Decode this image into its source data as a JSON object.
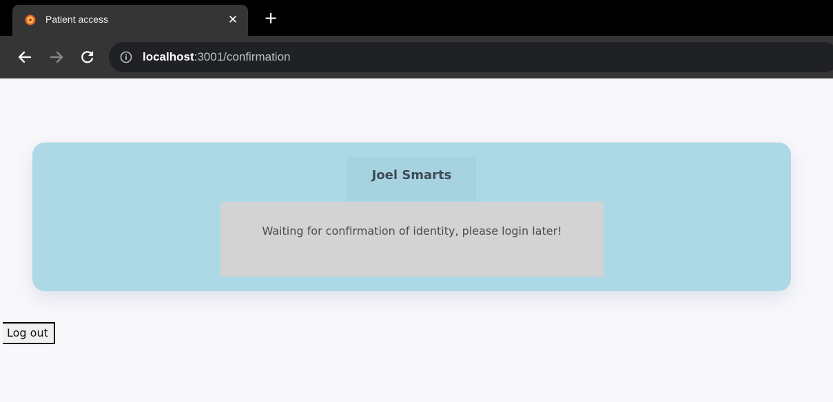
{
  "browser": {
    "tab": {
      "title": "Patient access",
      "close_symbol": "✕",
      "favicon": "app-favicon-icon"
    },
    "new_tab_symbol": "+",
    "toolbar": {
      "back_icon": "arrow-left-icon",
      "forward_icon": "arrow-right-icon",
      "reload_icon": "reload-icon",
      "info_icon": "info-circle-icon"
    },
    "url": {
      "host": "localhost",
      "rest": ":3001/confirmation"
    }
  },
  "page": {
    "user_name": "Joel Smarts",
    "message": "Waiting for confirmation of identity, please login later!",
    "logout_label": "Log out"
  },
  "colors": {
    "card_background": "#add8e6",
    "message_background": "#d3d3d3",
    "page_background": "#f8f8fb",
    "tab_background": "#353535",
    "titlebar_background": "#000000"
  }
}
